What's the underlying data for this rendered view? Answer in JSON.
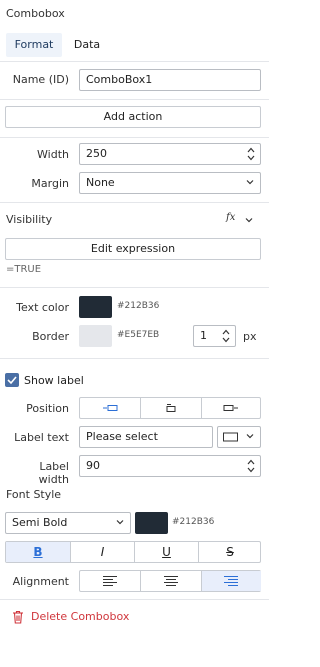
{
  "panel": {
    "title": "Combobox",
    "tabs": [
      {
        "label": "Format"
      },
      {
        "label": "Data"
      }
    ]
  },
  "name": {
    "label": "Name (ID)",
    "value": "ComboBox1"
  },
  "actions": {
    "add_label": "Add action"
  },
  "size": {
    "width_label": "Width",
    "width_value": "250",
    "margin_label": "Margin",
    "margin_value": "None"
  },
  "visibility": {
    "label": "Visibility",
    "fx_label": "fx",
    "edit_label": "Edit expression",
    "expression": "=TRUE"
  },
  "colors": {
    "text_color_label": "Text color",
    "text_color_hex": "#212B36",
    "text_color": "#212b36",
    "border_label": "Border",
    "border_hex": "#E5E7EB",
    "border_color": "#e5e7eb",
    "border_width": "1",
    "border_unit": "px"
  },
  "label_settings": {
    "show_label": "Show label",
    "show_label_checked": true,
    "position_label": "Position",
    "label_text_label": "Label text",
    "label_text_value": "Please select",
    "label_width_label": "Label width",
    "label_width_value": "90"
  },
  "font": {
    "section_label": "Font Style",
    "weight_value": "Semi Bold",
    "color_hex": "#212B36",
    "color": "#212b36",
    "bold": "B",
    "italic": "I",
    "underline": "U",
    "strike": "S",
    "alignment_label": "Alignment"
  },
  "delete": {
    "label": "Delete Combobox",
    "color": "#d0363c"
  },
  "accent": "#2c6fd6"
}
